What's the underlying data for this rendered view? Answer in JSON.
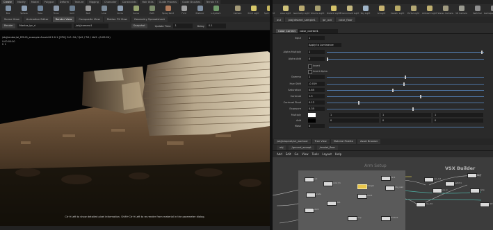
{
  "shelf": {
    "tabs": [
      "Create",
      "Modify",
      "Model",
      "Polygon",
      "Deform",
      "Texture",
      "Rigging",
      "Character",
      "Constraints",
      "Hair Utils",
      "Guide Process",
      "Guide Brushes",
      "Terrain FX"
    ],
    "tools": [
      {
        "label": "Box",
        "color": "#7d8fa3"
      },
      {
        "label": "Sphere",
        "color": "#8ea0b4"
      },
      {
        "label": "Tube",
        "color": "#6e8297"
      },
      {
        "label": "Torus",
        "color": "#8b98a8"
      },
      {
        "label": "Grid",
        "color": "#6b7d8f"
      },
      {
        "label": "Null",
        "color": "#9a9a9a"
      },
      {
        "label": "Line",
        "color": "#7b8a98"
      },
      {
        "label": "Circle",
        "color": "#8c9cae"
      },
      {
        "label": "Curve",
        "color": "#93a16e"
      },
      {
        "label": "Path",
        "color": "#7a8a6a"
      },
      {
        "label": "Spray Paint",
        "color": "#b07a5a"
      },
      {
        "label": "Font",
        "color": "#a0a0a0"
      },
      {
        "label": "Platonic",
        "color": "#7e8ea0"
      },
      {
        "label": "L-System",
        "color": "#6f9a6a"
      }
    ],
    "right_tools": [
      {
        "label": "Camera",
        "color": "#a49a78"
      },
      {
        "label": "Point Light",
        "color": "#d8c86a"
      },
      {
        "label": "Spot Light",
        "color": "#c8b860"
      },
      {
        "label": "Area Light",
        "color": "#cfc27a"
      },
      {
        "label": "Geometry Light",
        "color": "#b9aa70"
      },
      {
        "label": "Volume Light",
        "color": "#a8a070"
      },
      {
        "label": "Distant Light",
        "color": "#d4c26a"
      },
      {
        "label": "Environment Light",
        "color": "#c4b880"
      },
      {
        "label": "Sky Light",
        "color": "#9fb4c8"
      },
      {
        "label": "GI Light",
        "color": "#c6b270"
      },
      {
        "label": "Caustic Light",
        "color": "#b8aa66"
      },
      {
        "label": "Portal Light",
        "color": "#b4a874"
      },
      {
        "label": "Ambient Light",
        "color": "#c0b070"
      },
      {
        "label": "Stereo Camera",
        "color": "#a09a80"
      },
      {
        "label": "VR Camera",
        "color": "#9a9a90"
      },
      {
        "label": "Switcher",
        "color": "#909090"
      },
      {
        "label": "Gamepad Camera",
        "color": "#8a8a8a"
      }
    ]
  },
  "viewer": {
    "tabs": [
      "Scene View",
      "Animation Editor",
      "Render View",
      "Composite View",
      "Motion FX View",
      "Geometry Spreadsheet"
    ],
    "active_tab": 2,
    "controls": {
      "render_label": "Render",
      "renderer": "Mantra_ipr_ri",
      "camera": "/obj/camera1",
      "snapshot": "Snapshot",
      "update_label": "Update Time",
      "update_value": "1",
      "delay_label": "Delay",
      "delay_value": "0.1"
    },
    "overlay_path": "/obj/render/ai_ROUG_example  Arnold 6.2.0.1 [CPU] Cs?: 04 / Qs2 / Tr2 / Vol2 -(0:09:24)",
    "overlay_frame": "0:00:00:00\nfr 1",
    "overlay_help": "Ctrl+Left to show detailed pixel information. Shift+Ctrl+Left to re-render from material in the parameter dialog."
  },
  "params": {
    "tabs": [
      "out",
      "/obj/distant_sample1",
      "ipr_out",
      "color_floor"
    ],
    "node_type": "Color Correct",
    "node_name": "color_correct1",
    "rows": [
      {
        "kind": "label",
        "label": "Input",
        "value": "1"
      },
      {
        "kind": "label",
        "label": "",
        "value": "Apply to Luminance"
      },
      {
        "kind": "slider",
        "label": "Alpha Multiply",
        "value": "1",
        "t": 0.99
      },
      {
        "kind": "slider",
        "label": "Alpha Add",
        "value": "0",
        "t": 0.0
      },
      {
        "kind": "check",
        "label": "Invert",
        "checked": false
      },
      {
        "kind": "check",
        "label": "Invert Alpha",
        "checked": false
      },
      {
        "kind": "slider",
        "label": "Gamma",
        "value": "1",
        "t": 0.5
      },
      {
        "kind": "slider",
        "label": "Hue Shift",
        "value": "-0.019",
        "t": 0.49
      },
      {
        "kind": "slider",
        "label": "Saturation",
        "value": "0.85",
        "t": 0.42
      },
      {
        "kind": "slider",
        "label": "Contrast",
        "value": "1.5",
        "t": 0.6
      },
      {
        "kind": "slider",
        "label": "Contrast Pivot",
        "value": "0.12",
        "t": 0.2
      },
      {
        "kind": "slider",
        "label": "Exposure",
        "value": "0.35",
        "t": 0.55
      }
    ],
    "color_rows": [
      {
        "label": "Multiply",
        "swatch": "#ffffff",
        "values": [
          "1",
          "1",
          "1"
        ]
      },
      {
        "label": "Add",
        "swatch": "#000000",
        "values": [
          "0",
          "0",
          "0"
        ]
      },
      {
        "label": "Mask",
        "swatch": "",
        "values": [
          "0"
        ]
      }
    ]
  },
  "network": {
    "tabs": [
      "/obj/shopnet/ari_workout",
      "Tree View",
      "Material Palette",
      "Asset Browser"
    ],
    "path": [
      "obj",
      "/ground_aovopt",
      "/model_floor"
    ],
    "menu": [
      "Add",
      "Edit",
      "Go",
      "View",
      "Tools",
      "Layout",
      "Help"
    ],
    "box_title": "Arm Setup",
    "vsx_title": "VSX Builder",
    "nodes": [
      {
        "label": "out",
        "sel": false
      },
      {
        "label": "color_fix",
        "sel": false
      },
      {
        "label": "grade",
        "sel": false
      },
      {
        "label": "merge1",
        "sel": true
      },
      {
        "label": "over1",
        "sel": false
      },
      {
        "label": "mix1",
        "sel": false
      },
      {
        "label": "img_read",
        "sel": false
      },
      {
        "label": "file1",
        "sel": false
      },
      {
        "label": "blur1",
        "sel": false
      },
      {
        "label": "crop",
        "sel": false
      },
      {
        "label": "shader1",
        "sel": false
      },
      {
        "label": "vsx_out",
        "sel": false
      },
      {
        "label": "vsx_in",
        "sel": false
      },
      {
        "label": "vsx_mix",
        "sel": false
      },
      {
        "label": "switch1",
        "sel": false
      },
      {
        "label": "layer",
        "sel": false
      },
      {
        "label": "ramp",
        "sel": false
      },
      {
        "label": "fetch",
        "sel": false
      }
    ]
  },
  "colors": {
    "accent": "#4f76a5",
    "selected_node": "#e9c64a",
    "panel": "#2a2a2a"
  }
}
